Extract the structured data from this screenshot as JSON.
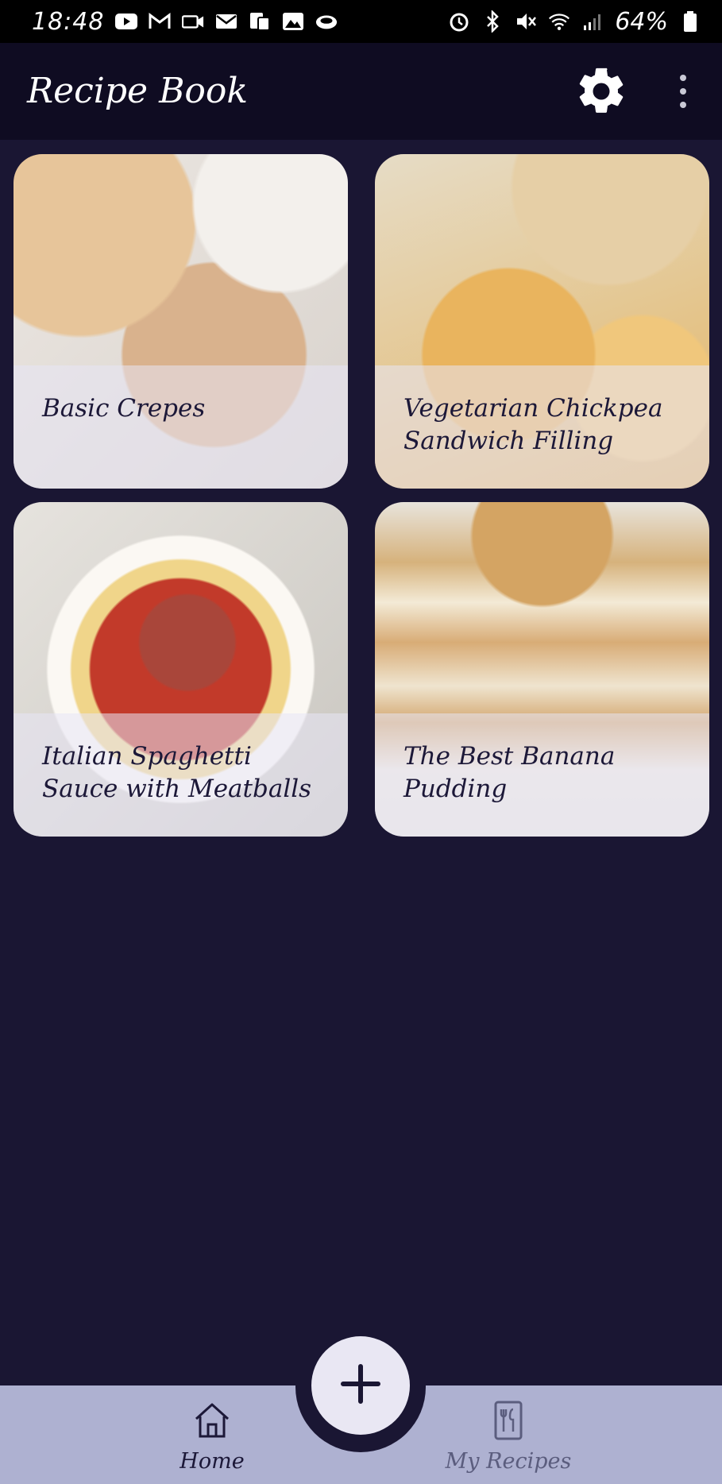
{
  "status_bar": {
    "time": "18:48",
    "battery": "64%",
    "left_icons": [
      "youtube-icon",
      "gmail-icon",
      "camera-icon",
      "mail-icon",
      "device-icon",
      "image-icon",
      "cloud-icon"
    ],
    "right_icons": [
      "alarm-icon",
      "bluetooth-icon",
      "mute-icon",
      "wifi-icon",
      "signal-icon",
      "battery-icon"
    ]
  },
  "app_bar": {
    "title": "Recipe Book",
    "settings_icon": "gear-icon",
    "more_icon": "more-vert-icon"
  },
  "recipes": [
    {
      "title": "Basic Crepes"
    },
    {
      "title": "Vegetarian Chickpea Sandwich Filling"
    },
    {
      "title": "Italian Spaghetti Sauce with Meatballs"
    },
    {
      "title": "The Best Banana Pudding"
    }
  ],
  "fab": {
    "icon": "plus-icon"
  },
  "bottom_nav": {
    "home": {
      "label": "Home",
      "icon": "home-icon"
    },
    "my_recipes": {
      "label": "My Recipes",
      "icon": "recipe-book-icon"
    }
  },
  "colors": {
    "background": "#1a1633",
    "app_bar": "#0f0c22",
    "bottom_bar": "#aeb1d1",
    "fab": "#e9e7f3",
    "label_text": "#1c1838"
  }
}
